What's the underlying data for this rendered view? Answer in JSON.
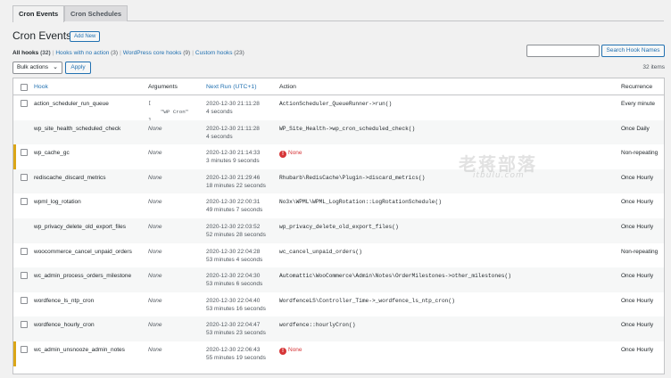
{
  "tabs": [
    {
      "label": "Cron Events",
      "active": true
    },
    {
      "label": "Cron Schedules",
      "active": false
    }
  ],
  "header": {
    "title": "Cron Events",
    "add_new_label": "Add New"
  },
  "filters": [
    {
      "label": "All hooks",
      "count": "(32)"
    },
    {
      "label": "Hooks with no action",
      "count": "(3)"
    },
    {
      "label": "WordPress core hooks",
      "count": "(9)"
    },
    {
      "label": "Custom hooks",
      "count": "(23)"
    }
  ],
  "search": {
    "value": "",
    "button_label": "Search Hook Names"
  },
  "bulk": {
    "selected": "Bulk actions",
    "apply_label": "Apply"
  },
  "items_count": "32 items",
  "table": {
    "columns": {
      "hook": "Hook",
      "arguments": "Arguments",
      "next_run": "Next Run (UTC+1)",
      "action": "Action",
      "recurrence": "Recurrence"
    },
    "rows": [
      {
        "hook": "action_scheduler_run_queue",
        "args": "[\n    \"WP Cron\"\n]",
        "args_code": true,
        "next_run": "2020-12-30 21:11:28",
        "next_run_rel": "4 seconds",
        "action": "ActionScheduler_QueueRunner->run()",
        "action_none": false,
        "recurrence": "Every minute",
        "checkbox": true,
        "highlight": false
      },
      {
        "hook": "wp_site_health_scheduled_check",
        "args": "None",
        "args_code": false,
        "next_run": "2020-12-30 21:11:28",
        "next_run_rel": "4 seconds",
        "action": "WP_Site_Health->wp_cron_scheduled_check()",
        "action_none": false,
        "recurrence": "Once Daily",
        "checkbox": false,
        "highlight": false
      },
      {
        "hook": "wp_cache_gc",
        "args": "None",
        "args_code": false,
        "next_run": "2020-12-30 21:14:33",
        "next_run_rel": "3 minutes 9 seconds",
        "action": "None",
        "action_none": true,
        "recurrence": "Non-repeating",
        "checkbox": true,
        "highlight": true
      },
      {
        "hook": "rediscache_discard_metrics",
        "args": "None",
        "args_code": false,
        "next_run": "2020-12-30 21:29:46",
        "next_run_rel": "18 minutes 22 seconds",
        "action": "Rhubarb\\RedisCache\\Plugin->discard_metrics()",
        "action_none": false,
        "recurrence": "Once Hourly",
        "checkbox": true,
        "highlight": false
      },
      {
        "hook": "wpml_log_rotation",
        "args": "None",
        "args_code": false,
        "next_run": "2020-12-30 22:00:31",
        "next_run_rel": "49 minutes 7 seconds",
        "action": "No3x\\WPML\\WPML_LogRotation::LogRotationSchedule()",
        "action_none": false,
        "recurrence": "Once Hourly",
        "checkbox": true,
        "highlight": false
      },
      {
        "hook": "wp_privacy_delete_old_export_files",
        "args": "None",
        "args_code": false,
        "next_run": "2020-12-30 22:03:52",
        "next_run_rel": "52 minutes 28 seconds",
        "action": "wp_privacy_delete_old_export_files()",
        "action_none": false,
        "recurrence": "Once Hourly",
        "checkbox": false,
        "highlight": false
      },
      {
        "hook": "woocommerce_cancel_unpaid_orders",
        "args": "None",
        "args_code": false,
        "next_run": "2020-12-30 22:04:28",
        "next_run_rel": "53 minutes 4 seconds",
        "action": "wc_cancel_unpaid_orders()",
        "action_none": false,
        "recurrence": "Non-repeating",
        "checkbox": true,
        "highlight": false
      },
      {
        "hook": "wc_admin_process_orders_milestone",
        "args": "None",
        "args_code": false,
        "next_run": "2020-12-30 22:04:30",
        "next_run_rel": "53 minutes 6 seconds",
        "action": "Automattic\\WooCommerce\\Admin\\Notes\\OrderMilestones->other_milestones()",
        "action_none": false,
        "recurrence": "Once Hourly",
        "checkbox": true,
        "highlight": false
      },
      {
        "hook": "wordfence_ls_ntp_cron",
        "args": "None",
        "args_code": false,
        "next_run": "2020-12-30 22:04:40",
        "next_run_rel": "53 minutes 16 seconds",
        "action": "WordfenceLS\\Controller_Time->_wordfence_ls_ntp_cron()",
        "action_none": false,
        "recurrence": "Once Hourly",
        "checkbox": true,
        "highlight": false
      },
      {
        "hook": "wordfence_hourly_cron",
        "args": "None",
        "args_code": false,
        "next_run": "2020-12-30 22:04:47",
        "next_run_rel": "53 minutes 23 seconds",
        "action": "wordfence::hourlyCron()",
        "action_none": false,
        "recurrence": "Once Hourly",
        "checkbox": true,
        "highlight": false
      },
      {
        "hook": "wc_admin_unsnooze_admin_notes",
        "args": "None",
        "args_code": false,
        "next_run": "2020-12-30 22:06:43",
        "next_run_rel": "55 minutes 19 seconds",
        "action": "None",
        "action_none": true,
        "recurrence": "Once Hourly",
        "checkbox": true,
        "highlight": true
      }
    ]
  },
  "watermark": {
    "main": "老蒋部落",
    "sub": "itbulu.com"
  },
  "colors": {
    "link": "#2271b1",
    "warning_border": "#dba617",
    "error": "#d63638"
  }
}
